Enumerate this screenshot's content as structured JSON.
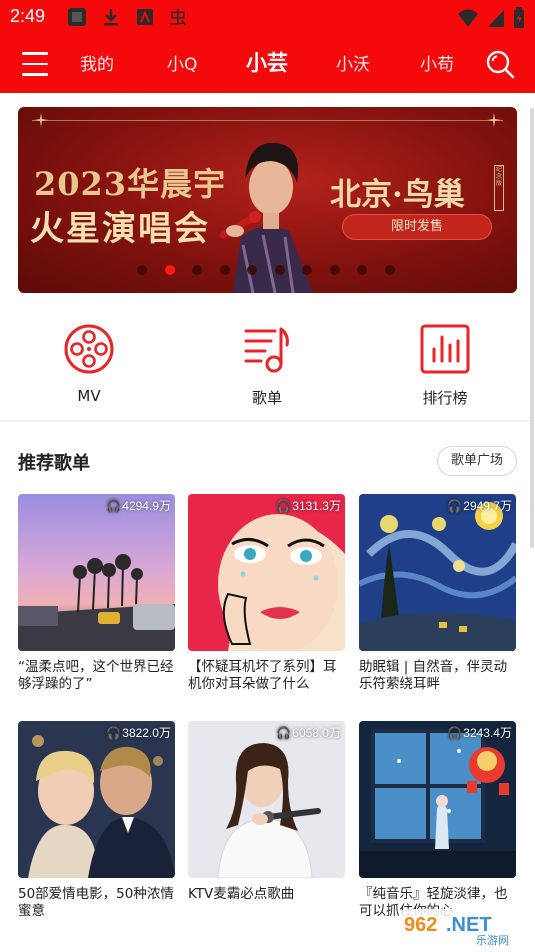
{
  "status_bar": {
    "time": "2:49"
  },
  "nav": {
    "tabs": [
      {
        "label": "我的",
        "active": false
      },
      {
        "label": "小Q",
        "active": false
      },
      {
        "label": "小芸",
        "active": true
      },
      {
        "label": "小沃",
        "active": false
      },
      {
        "label": "小苟",
        "active": false
      }
    ]
  },
  "banner": {
    "line1": "2023华晨宇",
    "line2": "火星演唱会",
    "venue": "北京·鸟巢",
    "venue_tag": "纪念版",
    "sale_button": "限时发售",
    "active_dot": 1,
    "dot_count": 10
  },
  "quick_entries": [
    {
      "label": "MV",
      "icon": "film-reel-icon"
    },
    {
      "label": "歌单",
      "icon": "playlist-icon"
    },
    {
      "label": "排行榜",
      "icon": "bar-chart-icon"
    }
  ],
  "recommend": {
    "title": "推荐歌单",
    "plaza_button": "歌单广场",
    "playlists": [
      {
        "count": "4294.9万",
        "title": "“温柔点吧，这个世界已经够浮躁的了”",
        "cover": "sunset-street"
      },
      {
        "count": "3131.3万",
        "title": "【怀疑耳机坏了系列】耳机你对耳朵做了什么",
        "cover": "pop-art-woman"
      },
      {
        "count": "2949.7万",
        "title": "助眠辑 | 自然音，伴灵动乐符萦绕耳畔",
        "cover": "starry-night"
      },
      {
        "count": "3822.0万",
        "title": "50部爱情电影，50种浓情蜜意",
        "cover": "movie-couple"
      },
      {
        "count": "6058.0万",
        "title": "KTV麦霸必点歌曲",
        "cover": "singer-mic"
      },
      {
        "count": "3243.4万",
        "title": "『纯音乐』轻旋淡律，也可以抓住你的心",
        "cover": "anime-window"
      }
    ]
  },
  "watermark": {
    "text1": "962",
    "text2": ".NET",
    "text3": "乐游网"
  },
  "colors": {
    "brand": "#f40a0a",
    "accent": "#e8232a"
  }
}
